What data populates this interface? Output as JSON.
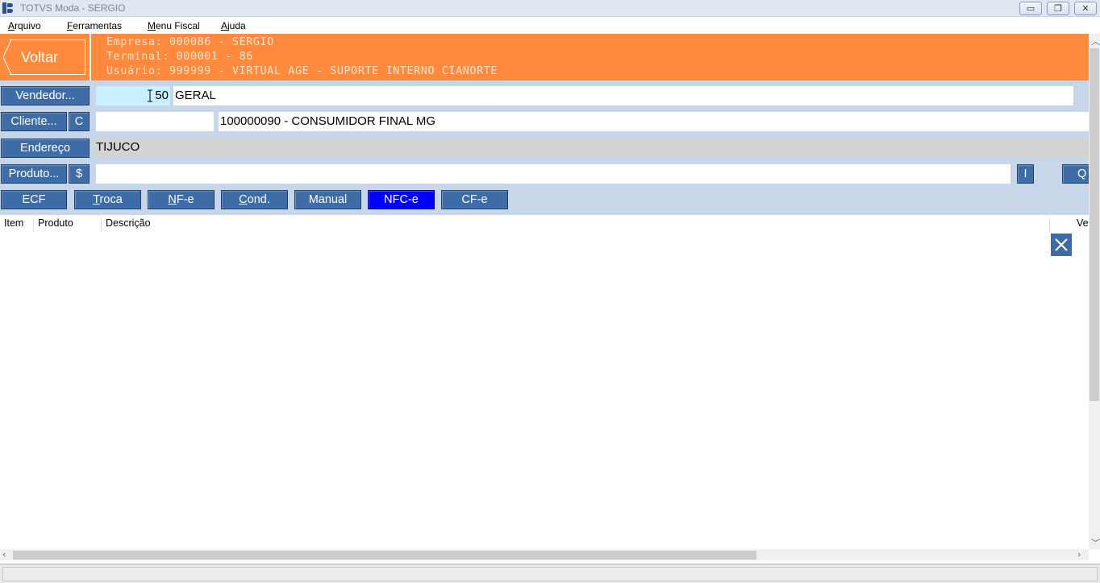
{
  "window": {
    "title": "TOTVS Moda - SERGIO",
    "controls": {
      "minimize": "▭",
      "restore": "❐",
      "close": "✕"
    }
  },
  "menu": {
    "items": [
      {
        "first": "A",
        "rest": "rquivo"
      },
      {
        "first": "F",
        "rest": "erramentas"
      },
      {
        "first": "M",
        "rest": "enu Fiscal"
      },
      {
        "first": "A",
        "rest": "juda"
      }
    ]
  },
  "header": {
    "back_label": "Voltar",
    "empresa": "Empresa: 000086 - SERGIO",
    "terminal": "Terminal: 000001 - 86",
    "usuario": "Usuário: 999999 - VIRTUAL AGE - SUPORTE INTERNO CIANORTE",
    "color": "#ff8a3d"
  },
  "form": {
    "vendedor_button": "Vendedor...",
    "vendedor_code": "50",
    "vendedor_name": "GERAL",
    "cliente_button": "Cliente...",
    "cliente_c_button": "C",
    "cliente_code": "",
    "cliente_name": "100000090 - CONSUMIDOR FINAL MG",
    "endereco_button": "Endereço",
    "endereco_value": "TIJUCO",
    "produto_button": "Produto...",
    "produto_price_button": "$",
    "produto_value": "",
    "produto_i_button": "I",
    "produto_q_button": "Q"
  },
  "actions": {
    "ecf": "ECF",
    "troca_first": "T",
    "troca_rest": "roca",
    "nfe_first": "N",
    "nfe_rest": "F-e",
    "cond_first": "C",
    "cond_rest": "ond.",
    "manual": "Manual",
    "nfce": "NFC-e",
    "cfe": "CF-e",
    "active": "NFC-e",
    "active_color": "#0000ff",
    "button_color": "#3e6ca6"
  },
  "table": {
    "columns": [
      "Item",
      "Produto",
      "Descrição",
      "Ve"
    ],
    "rows": []
  },
  "icons": {
    "close_items": "close-icon",
    "app": "totvs-app-icon"
  }
}
